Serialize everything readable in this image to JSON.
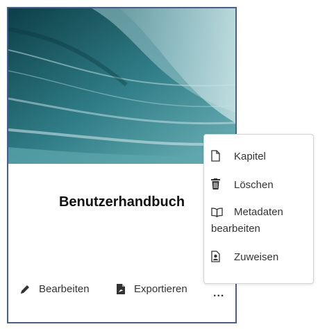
{
  "card": {
    "title": "Benutzerhandbuch",
    "actions": {
      "edit_label": "Bearbeiten",
      "export_label": "Exportieren",
      "more_label": "..."
    }
  },
  "context_menu": {
    "items": [
      {
        "label": "Kapitel",
        "icon": "document-icon"
      },
      {
        "label": "Löschen",
        "icon": "trash-icon"
      },
      {
        "label_line1": "Metadaten",
        "label_line2": "bearbeiten",
        "icon": "book-icon"
      },
      {
        "label": "Zuweisen",
        "icon": "assign-icon"
      }
    ]
  },
  "colors": {
    "card_border": "#4a5d8c",
    "cover_dark": "#0f4a52",
    "cover_light": "#7fbfc4"
  }
}
